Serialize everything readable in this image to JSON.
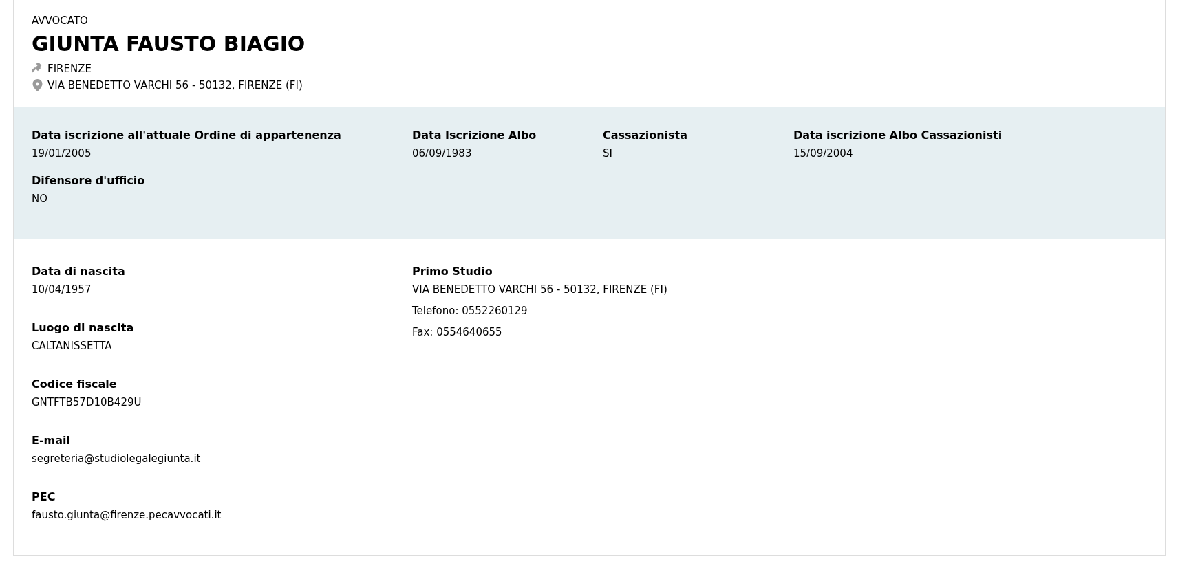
{
  "header": {
    "role": "AVVOCATO",
    "name": "GIUNTA FAUSTO BIAGIO",
    "court": "FIRENZE",
    "address": "VIA BENEDETTO VARCHI 56 - 50132, FIRENZE (FI)"
  },
  "registration": [
    [
      {
        "label": "Data iscrizione all'attuale Ordine di appartenenza",
        "value": "19/01/2005"
      },
      {
        "label": "Data Iscrizione Albo",
        "value": "06/09/1983"
      },
      {
        "label": "Cassazionista",
        "value": "SI"
      },
      {
        "label": "Data iscrizione Albo Cassazionisti",
        "value": "15/09/2004"
      }
    ],
    [
      {
        "label": "Difensore d'ufficio",
        "value": "NO"
      }
    ]
  ],
  "personal": [
    {
      "label": "Data di nascita",
      "value": "10/04/1957"
    },
    {
      "label": "Luogo di nascita",
      "value": "CALTANISSETTA"
    },
    {
      "label": "Codice fiscale",
      "value": "GNTFTB57D10B429U"
    },
    {
      "label": "E-mail",
      "value": "segreteria@studiolegalegiunta.it"
    },
    {
      "label": "PEC",
      "value": "fausto.giunta@firenze.pecavvocati.it"
    }
  ],
  "studio": {
    "label": "Primo Studio",
    "lines": [
      "VIA BENEDETTO VARCHI 56 - 50132, FIRENZE (FI)",
      "Telefono: 0552260129",
      "Fax: 0554640655"
    ]
  }
}
